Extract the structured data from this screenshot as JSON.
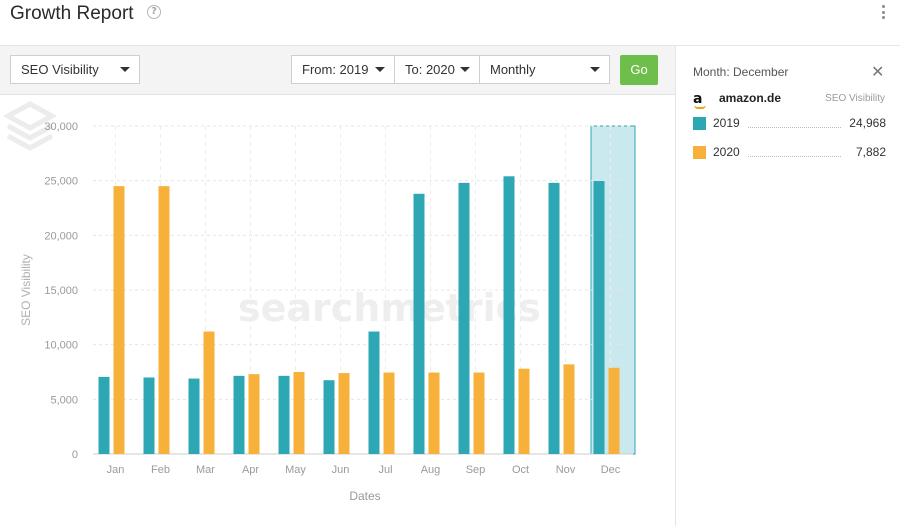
{
  "header": {
    "title": "Growth Report",
    "help_glyph": "?"
  },
  "toolbar": {
    "metric_select": "SEO Visibility",
    "from_select": "From: 2019",
    "to_select": "To: 2020",
    "interval_select": "Monthly",
    "go_label": "Go"
  },
  "side_panel": {
    "month_label": "Month: December",
    "close_glyph": "✕",
    "domain": "amazon.de",
    "metric": "SEO Visibility",
    "rows": [
      {
        "year": "2019",
        "value": "24,968",
        "color": "#2ea7b5"
      },
      {
        "year": "2020",
        "value": "7,882",
        "color": "#f7b03a"
      }
    ]
  },
  "watermark": "searchmetrics",
  "colors": {
    "series_2019": "#2ea7b5",
    "series_2020": "#f7b03a",
    "highlight": "#c9e9ee"
  },
  "chart_data": {
    "type": "bar",
    "ylabel": "SEO Visibility",
    "xlabel": "Dates",
    "ylim": [
      0,
      30000
    ],
    "yticks": [
      "0",
      "5,000",
      "10,000",
      "15,000",
      "20,000",
      "25,000",
      "30,000"
    ],
    "ytick_values": [
      0,
      5000,
      10000,
      15000,
      20000,
      25000,
      30000
    ],
    "categories": [
      "Jan",
      "Feb",
      "Mar",
      "Apr",
      "May",
      "Jun",
      "Jul",
      "Aug",
      "Sep",
      "Oct",
      "Nov",
      "Dec"
    ],
    "highlighted_category": "Dec",
    "series": [
      {
        "name": "2019",
        "values": [
          7050,
          7000,
          6900,
          7150,
          7150,
          6750,
          11200,
          23800,
          24800,
          25400,
          24800,
          24968
        ]
      },
      {
        "name": "2020",
        "values": [
          24500,
          24500,
          11200,
          7300,
          7500,
          7400,
          7450,
          7450,
          7450,
          7800,
          8200,
          7882
        ]
      }
    ]
  }
}
